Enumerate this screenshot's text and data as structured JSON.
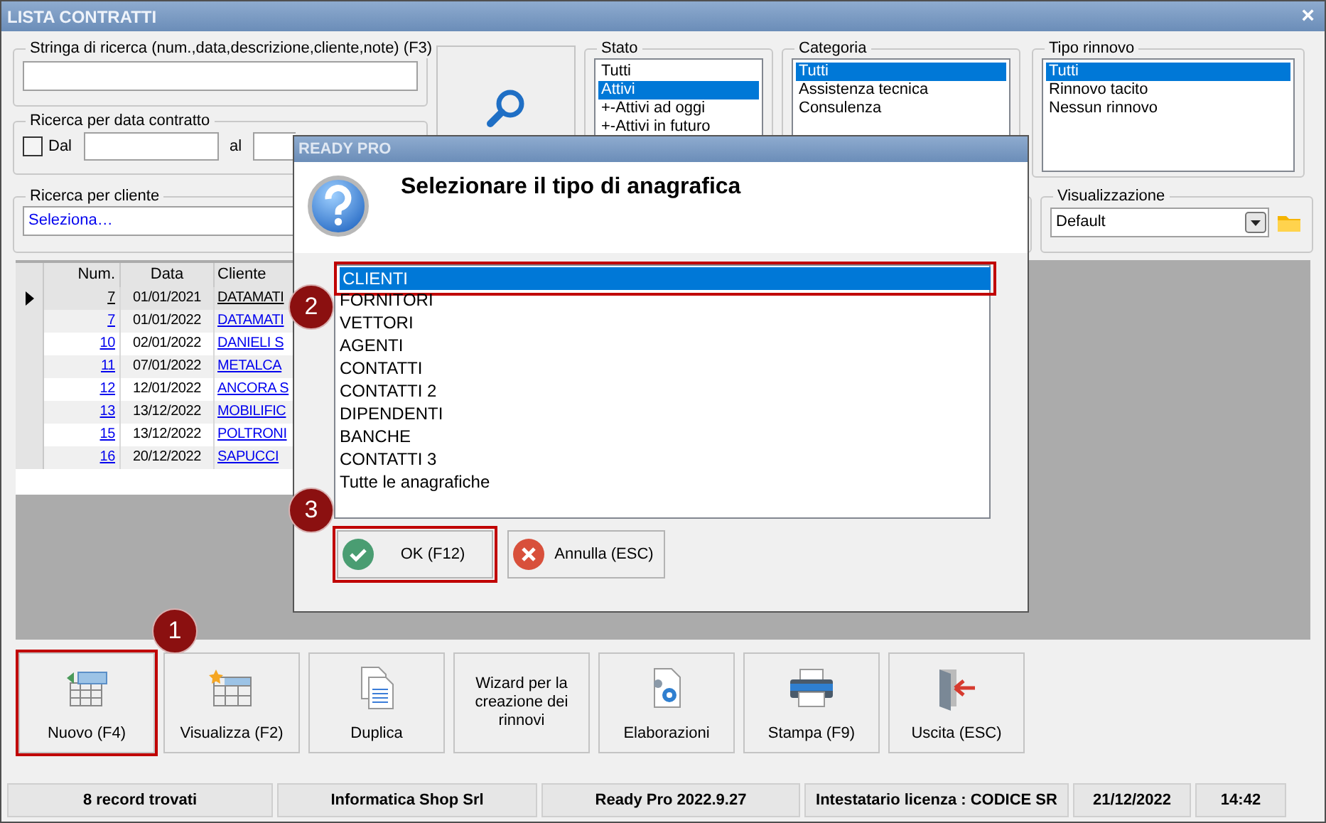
{
  "window": {
    "title": "LISTA CONTRATTI",
    "close_glyph": "×"
  },
  "search": {
    "label": "Stringa di ricerca (num.,data,descrizione,cliente,note) (F3)"
  },
  "date_filter": {
    "label": "Ricerca per data contratto",
    "from_label": "Dal",
    "from_checked": false,
    "to_label": "al"
  },
  "client_filter": {
    "label": "Ricerca per cliente",
    "value": "Seleziona…"
  },
  "lists": [
    {
      "label": "Stato",
      "items": [
        {
          "label": "Tutti",
          "selected": false
        },
        {
          "label": "Attivi",
          "selected": true
        },
        {
          "label": "+-Attivi ad oggi",
          "selected": false
        },
        {
          "label": "+-Attivi in futuro",
          "selected": false
        }
      ]
    },
    {
      "label": "Categoria",
      "items": [
        {
          "label": "Tutti",
          "selected": true
        },
        {
          "label": "Assistenza tecnica",
          "selected": false
        },
        {
          "label": "Consulenza",
          "selected": false
        }
      ]
    },
    {
      "label": "Tipo rinnovo",
      "items": [
        {
          "label": "Tutti",
          "selected": true
        },
        {
          "label": "Rinnovo tacito",
          "selected": false
        },
        {
          "label": "Nessun rinnovo",
          "selected": false
        }
      ]
    }
  ],
  "view": {
    "label": "Visualizzazione",
    "value": "Default"
  },
  "table": {
    "columns": [
      "Num.",
      "Data",
      "Cliente"
    ],
    "rows": [
      {
        "num": "7",
        "date": "01/01/2021",
        "client": "DATAMATI",
        "current": true
      },
      {
        "num": "7",
        "date": "01/01/2022",
        "client": "DATAMATI",
        "current": false
      },
      {
        "num": "10",
        "date": "02/01/2022",
        "client": "DANIELI S",
        "current": false
      },
      {
        "num": "11",
        "date": "07/01/2022",
        "client": "METALCA",
        "current": false
      },
      {
        "num": "12",
        "date": "12/01/2022",
        "client": "ANCORA S",
        "current": false
      },
      {
        "num": "13",
        "date": "13/12/2022",
        "client": "MOBILIFIC",
        "current": false
      },
      {
        "num": "15",
        "date": "13/12/2022",
        "client": "POLTRONI",
        "current": false
      },
      {
        "num": "16",
        "date": "20/12/2022",
        "client": "SAPUCCI",
        "current": false
      }
    ]
  },
  "toolbar": [
    {
      "label": "Nuovo (F4)",
      "kind": "new",
      "highlighted": true
    },
    {
      "label": "Visualizza (F2)",
      "kind": "view",
      "highlighted": false
    },
    {
      "label": "Duplica",
      "kind": "duplicate",
      "highlighted": false
    },
    {
      "label": "Wizard per la creazione dei rinnovi",
      "kind": "text",
      "highlighted": false
    },
    {
      "label": "Elaborazioni",
      "kind": "process",
      "highlighted": false
    },
    {
      "label": "Stampa (F9)",
      "kind": "print",
      "highlighted": false
    },
    {
      "label": "Uscita (ESC)",
      "kind": "exit",
      "highlighted": false
    }
  ],
  "status_bar": [
    "8 record trovati",
    "Informatica Shop Srl",
    "Ready Pro 2022.9.27",
    "Intestatario licenza : CODICE SR",
    "21/12/2022",
    "14:42"
  ],
  "dialog": {
    "title": "READY PRO",
    "message": "Selezionare il tipo di anagrafica",
    "items": [
      {
        "label": "CLIENTI",
        "selected": true,
        "highlighted": true
      },
      {
        "label": "FORNITORI",
        "selected": false,
        "highlighted": false
      },
      {
        "label": "VETTORI",
        "selected": false,
        "highlighted": false
      },
      {
        "label": "AGENTI",
        "selected": false,
        "highlighted": false
      },
      {
        "label": "CONTATTI",
        "selected": false,
        "highlighted": false
      },
      {
        "label": "CONTATTI 2",
        "selected": false,
        "highlighted": false
      },
      {
        "label": "DIPENDENTI",
        "selected": false,
        "highlighted": false
      },
      {
        "label": "BANCHE",
        "selected": false,
        "highlighted": false
      },
      {
        "label": "CONTATTI 3",
        "selected": false,
        "highlighted": false
      },
      {
        "label": "Tutte le anagrafiche",
        "selected": false,
        "highlighted": false
      }
    ],
    "buttons": [
      {
        "label": "OK (F12)",
        "kind": "ok",
        "highlighted": true
      },
      {
        "label": "Annulla (ESC)",
        "kind": "cancel",
        "highlighted": false
      }
    ]
  },
  "annotations": [
    "1",
    "2",
    "3"
  ]
}
